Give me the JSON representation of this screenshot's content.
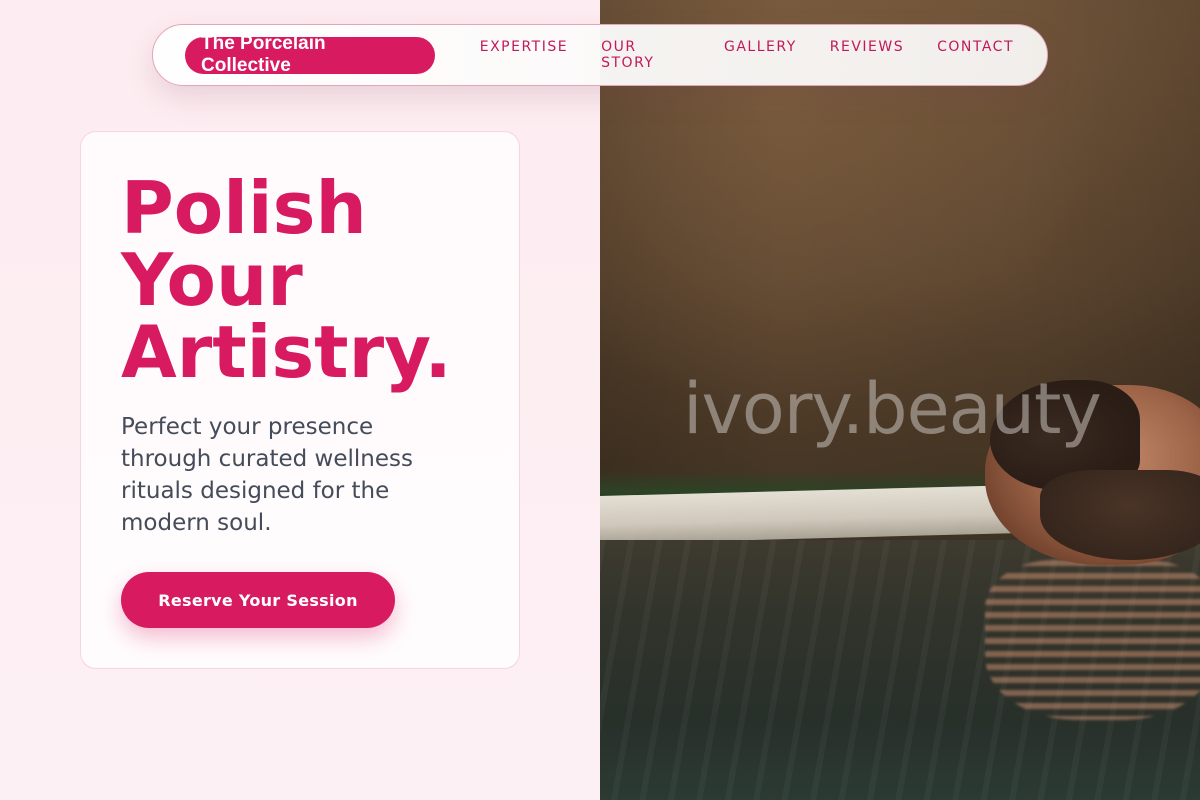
{
  "brand": {
    "name": "The Porcelain Collective"
  },
  "nav": {
    "items": [
      {
        "label": "EXPERTISE"
      },
      {
        "label": "OUR STORY"
      },
      {
        "label": "GALLERY"
      },
      {
        "label": "REVIEWS"
      },
      {
        "label": "CONTACT"
      }
    ]
  },
  "hero": {
    "headline_lines": [
      "Polish",
      "Your",
      "Artistry."
    ],
    "subtext": "Perfect your presence through curated wellness rituals designed for the modern soul.",
    "cta_label": "Reserve Your Session"
  },
  "photo": {
    "watermark": "ivory.beauty"
  },
  "colors": {
    "accent": "#d81b60",
    "nav_text": "#c2185b",
    "body_text": "#444b59",
    "page_bg": "#fdf0f3"
  }
}
